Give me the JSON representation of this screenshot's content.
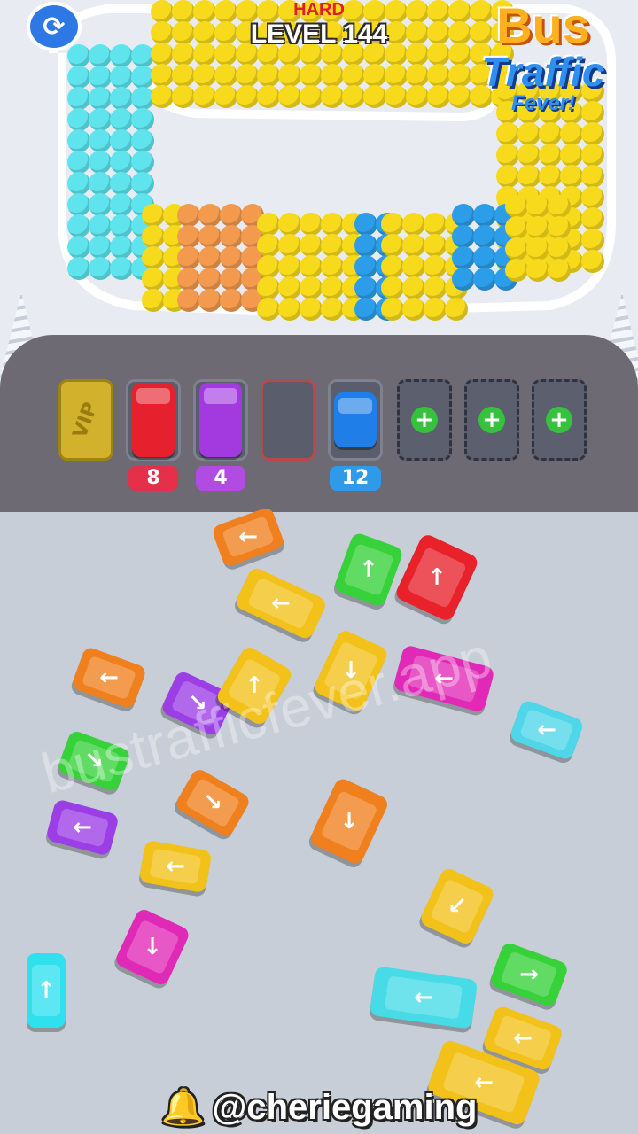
{
  "hud": {
    "difficulty": "HARD",
    "level": "LEVEL 144",
    "restart_icon": "restart-icon"
  },
  "logo": {
    "line1": "Bus",
    "line2": "Traffic",
    "line3": "Fever!"
  },
  "queue": {
    "colors_in_order": [
      "cyan",
      "yellow",
      "orange",
      "yellow",
      "blue",
      "yellow",
      "blue",
      "yellow"
    ]
  },
  "slots": [
    {
      "type": "vip",
      "label": "VIP"
    },
    {
      "type": "occupied",
      "vehicle_color": "#e6212d",
      "count": "8",
      "count_color": "#e5304a"
    },
    {
      "type": "occupied",
      "vehicle_color": "#a23ae0",
      "count": "4",
      "count_color": "#b04ce0"
    },
    {
      "type": "empty"
    },
    {
      "type": "occupied",
      "vehicle_color": "#1f7ee8",
      "count": "12",
      "count_color": "#2f9ae8"
    },
    {
      "type": "locked",
      "icon": "plus-icon"
    },
    {
      "type": "locked",
      "icon": "plus-icon"
    },
    {
      "type": "locked",
      "icon": "plus-icon"
    }
  ],
  "vehicles": [
    {
      "color": "#f07f1e",
      "arrow": "←"
    },
    {
      "color": "#37d13a",
      "arrow": "↑"
    },
    {
      "color": "#e8212b",
      "arrow": "↑"
    },
    {
      "color": "#f3c21a",
      "arrow": "←"
    },
    {
      "color": "#f07f1e",
      "arrow": "←"
    },
    {
      "color": "#9b3ee6",
      "arrow": "↘"
    },
    {
      "color": "#f3c21a",
      "arrow": "↑"
    },
    {
      "color": "#f3c21a",
      "arrow": "↓"
    },
    {
      "color": "#e02ab7",
      "arrow": "←"
    },
    {
      "color": "#4fd6e8",
      "arrow": "←"
    },
    {
      "color": "#37d13a",
      "arrow": "↘"
    },
    {
      "color": "#f07f1e",
      "arrow": "↘"
    },
    {
      "color": "#f07f1e",
      "arrow": "↓"
    },
    {
      "color": "#9b3ee6",
      "arrow": "←"
    },
    {
      "color": "#f3c21a",
      "arrow": "←"
    },
    {
      "color": "#f3c21a",
      "arrow": "↙"
    },
    {
      "color": "#2fe0ef",
      "arrow": "↑"
    },
    {
      "color": "#e02ab7",
      "arrow": "↓"
    },
    {
      "color": "#46dbe6",
      "arrow": "←"
    },
    {
      "color": "#37d13a",
      "arrow": "→"
    },
    {
      "color": "#f3c21a",
      "arrow": "←"
    },
    {
      "color": "#f3c21a",
      "arrow": "←"
    }
  ],
  "watermark": "bustrafficfever.app",
  "footer": {
    "handle": "@cheriegaming",
    "bell_icon": "bell-icon"
  }
}
